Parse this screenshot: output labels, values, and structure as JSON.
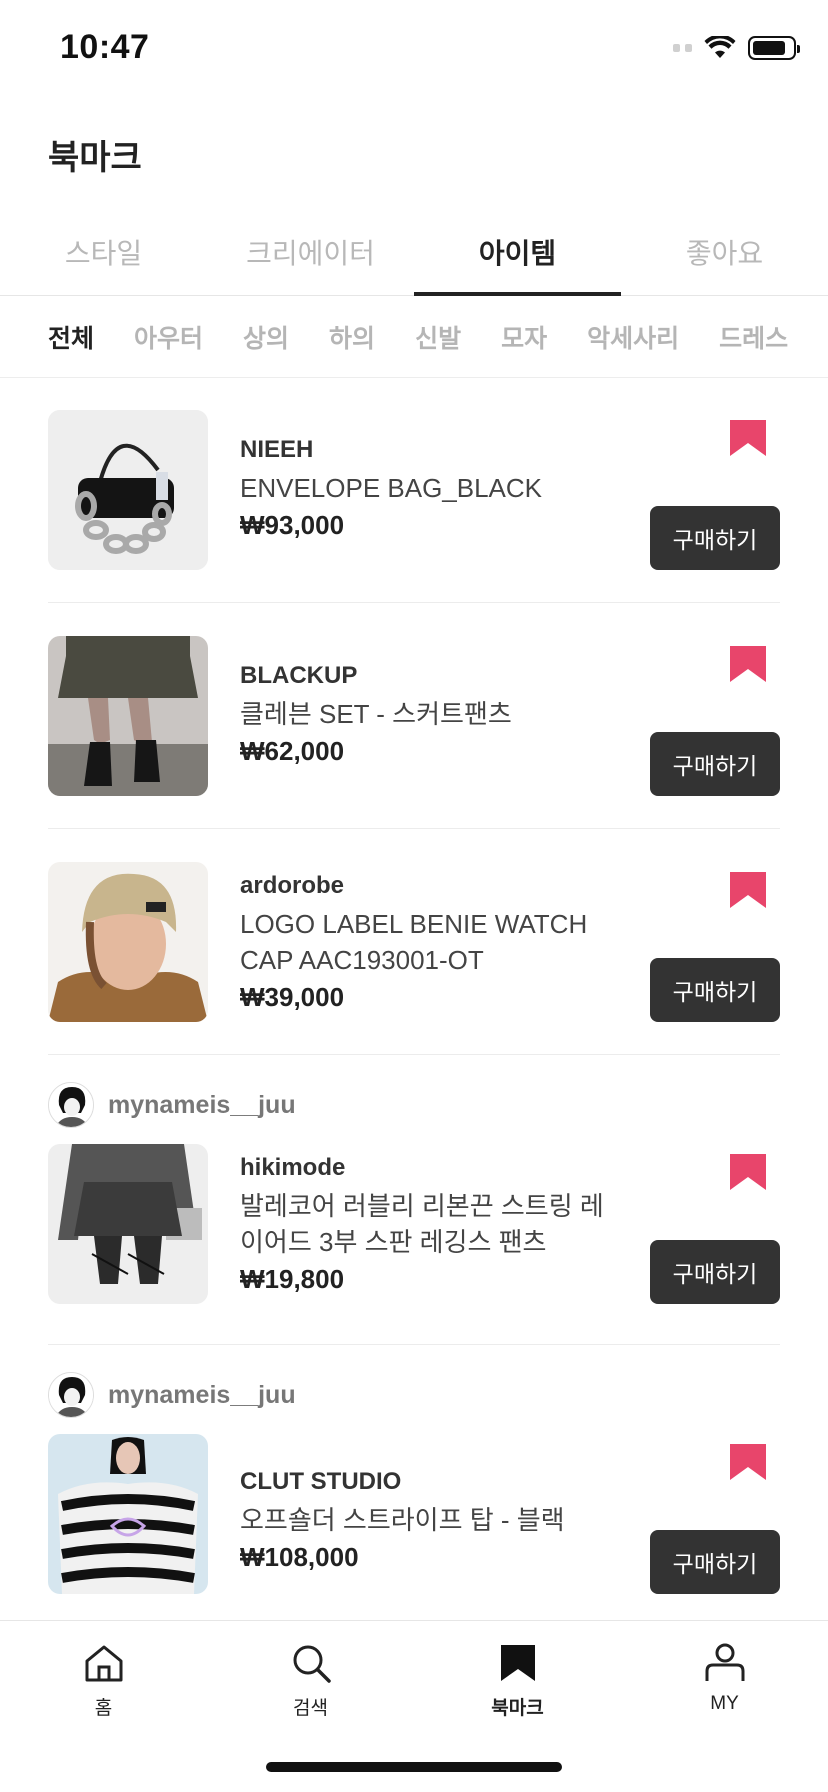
{
  "status_bar": {
    "time": "10:47"
  },
  "page": {
    "title": "북마크"
  },
  "main_tabs": [
    {
      "label": "스타일",
      "active": false
    },
    {
      "label": "크리에이터",
      "active": false
    },
    {
      "label": "아이템",
      "active": true
    },
    {
      "label": "좋아요",
      "active": false
    }
  ],
  "categories": [
    {
      "label": "전체",
      "active": true
    },
    {
      "label": "아우터",
      "active": false
    },
    {
      "label": "상의",
      "active": false
    },
    {
      "label": "하의",
      "active": false
    },
    {
      "label": "신발",
      "active": false
    },
    {
      "label": "모자",
      "active": false
    },
    {
      "label": "악세사리",
      "active": false
    },
    {
      "label": "드레스",
      "active": false
    }
  ],
  "items": [
    {
      "brand": "NIEEH",
      "name": "ENVELOPE BAG_BLACK",
      "price": "₩93,000",
      "buy_label": "구매하기",
      "user": ""
    },
    {
      "brand": "BLACKUP",
      "name": "클레븐 SET - 스커트팬츠",
      "price": "₩62,000",
      "buy_label": "구매하기",
      "user": ""
    },
    {
      "brand": "ardorobe",
      "name": "LOGO LABEL BENIE WATCH CAP AAC193001-OT",
      "price": "₩39,000",
      "buy_label": "구매하기",
      "user": ""
    },
    {
      "brand": "hikimode",
      "name": "발레코어 러블리 리본끈 스트링 레이어드 3부 스판 레깅스 팬츠",
      "price": "₩19,800",
      "buy_label": "구매하기",
      "user": "mynameis__juu"
    },
    {
      "brand": "CLUT STUDIO",
      "name": "오프숄더 스트라이프 탑 - 블랙",
      "price": "₩108,000",
      "buy_label": "구매하기",
      "user": "mynameis__juu"
    }
  ],
  "bottom_nav": [
    {
      "label": "홈",
      "icon": "home-icon",
      "active": false
    },
    {
      "label": "검색",
      "icon": "search-icon",
      "active": false
    },
    {
      "label": "북마크",
      "icon": "bookmark-icon",
      "active": true
    },
    {
      "label": "MY",
      "icon": "user-icon",
      "active": false
    }
  ],
  "colors": {
    "accent": "#e8456b",
    "button": "#333333"
  }
}
